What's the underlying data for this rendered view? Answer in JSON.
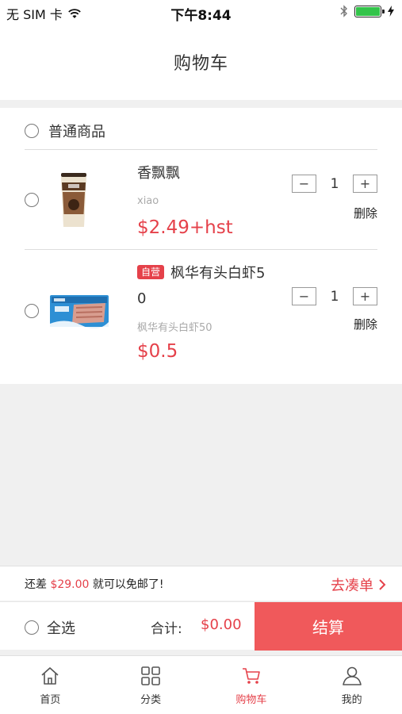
{
  "status_bar": {
    "carrier": "无 SIM 卡",
    "time": "下午8:44"
  },
  "nav": {
    "title": "购物车"
  },
  "group": {
    "title": "普通商品"
  },
  "items": [
    {
      "name": "香飘飘",
      "subtitle": "xiao",
      "price": "$2.49+hst",
      "quantity": "1",
      "delete_label": "删除",
      "image_icon": "milk-tea-cup"
    },
    {
      "tag": "自营",
      "name_line1": "枫华有头白虾5",
      "name_line2": "0",
      "subtitle": "枫华有头白虾50",
      "price": "$0.5",
      "quantity": "1",
      "delete_label": "删除",
      "image_icon": "shrimp-package"
    }
  ],
  "free_shipping": {
    "prefix": "还差 ",
    "amount": "$29.00",
    "suffix": " 就可以免邮了!",
    "link_label": "去凑单"
  },
  "checkout": {
    "select_all_label": "全选",
    "total_label": "合计:",
    "total_value": "$0.00",
    "button_label": "结算"
  },
  "tabs": [
    {
      "label": "首页",
      "icon": "home-icon"
    },
    {
      "label": "分类",
      "icon": "grid-icon"
    },
    {
      "label": "购物车",
      "icon": "cart-icon",
      "active": true
    },
    {
      "label": "我的",
      "icon": "user-icon"
    }
  ],
  "colors": {
    "accent": "#e5414a",
    "checkout_button": "#f0595b",
    "background": "#f0f0f0"
  }
}
